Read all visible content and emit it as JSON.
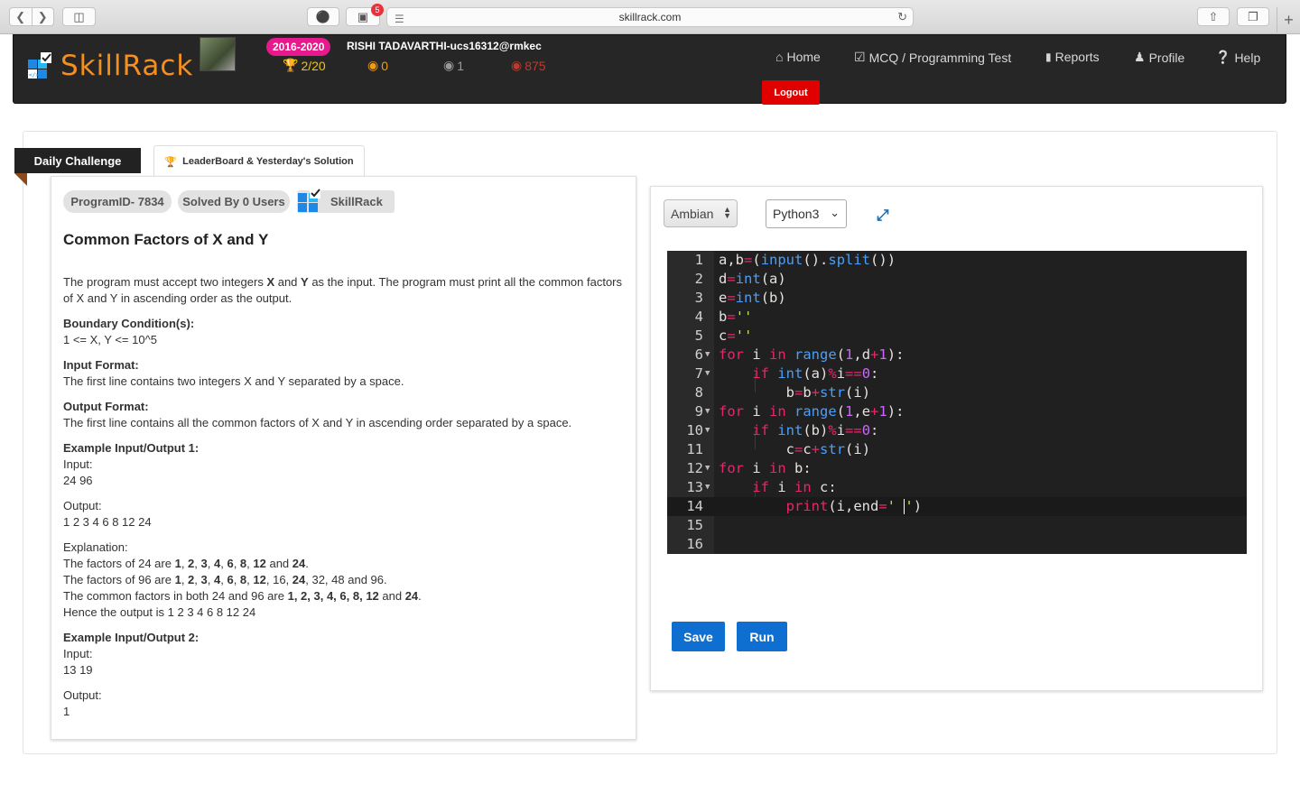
{
  "browser": {
    "url": "skillrack.com",
    "extension_badge": "5",
    "new_tab": "+"
  },
  "header": {
    "logo_text": "SkillRack",
    "batch": "2016-2020",
    "user": "RISHI TADAVARTHI-ucs16312@rmkec",
    "stats": [
      {
        "icon": "trophy-icon",
        "value": "2/20",
        "color": "#f1c40f"
      },
      {
        "icon": "gold-medal-icon",
        "value": "0",
        "color": "#f39c12"
      },
      {
        "icon": "silver-medal-icon",
        "value": "1",
        "color": "#9a9a9a"
      },
      {
        "icon": "bronze-medal-icon",
        "value": "875",
        "color": "#c0392b"
      }
    ],
    "nav": [
      {
        "icon": "home-icon",
        "label": "Home"
      },
      {
        "icon": "checkbox-icon",
        "label": "MCQ / Programming Test"
      },
      {
        "icon": "bar-chart-icon",
        "label": "Reports"
      },
      {
        "icon": "user-icon",
        "label": "Profile"
      },
      {
        "icon": "question-icon",
        "label": "Help"
      }
    ],
    "logout": "Logout"
  },
  "tabs": {
    "daily": "Daily Challenge",
    "leaderboard": "LeaderBoard & Yesterday's Solution"
  },
  "question": {
    "program_id": "ProgramID- 7834",
    "solved_by": "Solved By 0 Users",
    "source": "SkillRack",
    "title": "Common Factors of X and Y",
    "desc_1": "The program must accept two integers ",
    "desc_x": "X",
    "desc_2": " and ",
    "desc_y": "Y",
    "desc_3": " as the input. The program must print all the common factors of X and Y in ascending order as the output.",
    "boundary_label": "Boundary Condition(s):",
    "boundary": "1 <= X, Y <= 10^5",
    "input_format_label": "Input Format:",
    "input_format": "The first line contains two integers X and Y separated by a space.",
    "output_format_label": "Output Format:",
    "output_format": "The first line contains all the common factors of X and Y in ascending order separated by a space.",
    "example1_label": "Example Input/Output 1:",
    "input_label": "Input:",
    "example1_input": "24 96",
    "output_label": "Output:",
    "example1_output": "1 2 3 4 6 8 12 24",
    "explanation_label": "Explanation:",
    "exp_line1_pre": "The factors of 24 are ",
    "exp_line2_pre": "The factors of 96 are ",
    "exp_line3_pre": "The common factors in both 24 and 96 are ",
    "exp_line3_bold": "1, 2, 3, 4, 6, 8, 12",
    "exp_line3_and": " and ",
    "exp_line3_end": "24",
    "exp_line4": "Hence the output is 1 2 3 4 6 8 12 24",
    "example2_label": "Example Input/Output 2:",
    "example2_input": "13 19",
    "example2_output": "1"
  },
  "editor": {
    "theme": "Ambian",
    "language": "Python3",
    "line_numbers": [
      "1",
      "2",
      "3",
      "4",
      "5",
      "6",
      "7",
      "8",
      "9",
      "10",
      "11",
      "12",
      "13",
      "14",
      "15",
      "16"
    ],
    "code": {
      "l1": [
        "a,b",
        "=",
        "(",
        "input",
        "().",
        "split",
        "())"
      ],
      "l2": [
        "d",
        "=",
        "int",
        "(a)"
      ],
      "l3": [
        "e",
        "=",
        "int",
        "(b)"
      ],
      "l4": [
        "b",
        "=",
        "''"
      ],
      "l5": [
        "c",
        "=",
        "''"
      ],
      "l6": [
        "for",
        " i ",
        "in",
        " ",
        "range",
        "(",
        "1",
        ",d",
        "+",
        "1",
        "):"
      ],
      "l7": [
        "    ",
        "if",
        " ",
        "int",
        "(a)",
        "%",
        "i",
        "==",
        "0",
        ":"
      ],
      "l8": [
        "        b",
        "=",
        "b",
        "+",
        "str",
        "(i)"
      ],
      "l9": [
        "for",
        " i ",
        "in",
        " ",
        "range",
        "(",
        "1",
        ",e",
        "+",
        "1",
        "):"
      ],
      "l10": [
        "    ",
        "if",
        " ",
        "int",
        "(b)",
        "%",
        "i",
        "==",
        "0",
        ":"
      ],
      "l11": [
        "        c",
        "=",
        "c",
        "+",
        "str",
        "(i)"
      ],
      "l12": [
        "for",
        " i ",
        "in",
        " b:"
      ],
      "l13": [
        "    ",
        "if",
        " i ",
        "in",
        " c:"
      ],
      "l14": [
        "        ",
        "print",
        "(i,end",
        "=",
        "' ",
        "'",
        ")"
      ]
    }
  },
  "buttons": {
    "save": "Save",
    "run": "Run"
  }
}
